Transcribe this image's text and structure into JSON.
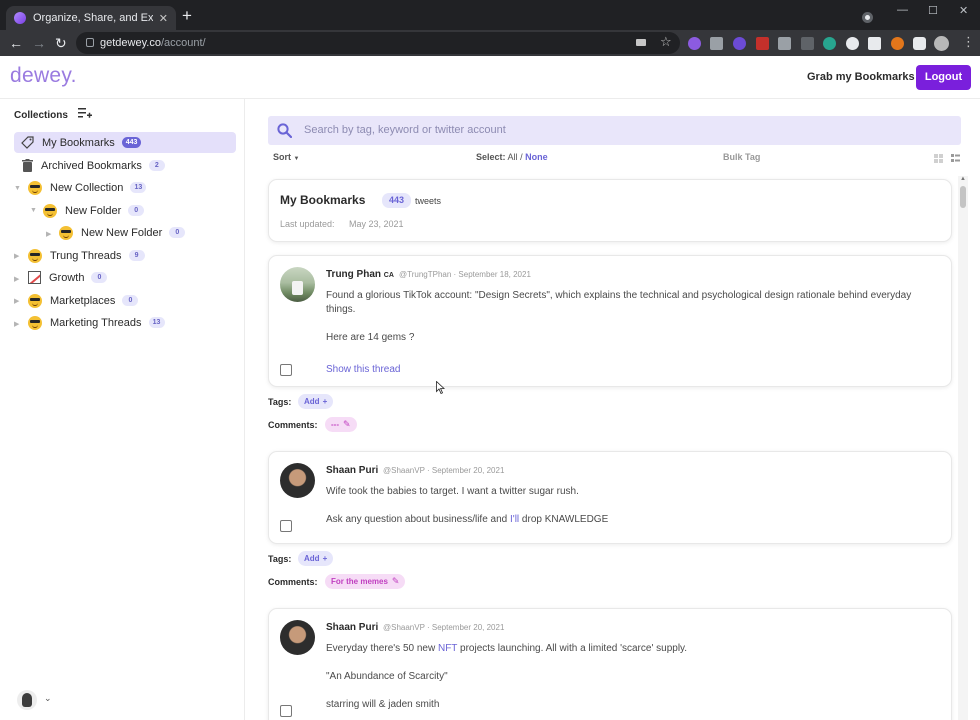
{
  "browser": {
    "tab_title": "Organize, Share, and Export Twitt",
    "url_host": "getdewey.co",
    "url_path": "/account/"
  },
  "header": {
    "logo": "dewey.",
    "grab_label": "Grab my Bookmarks",
    "logout_label": "Logout"
  },
  "sidebar": {
    "title": "Collections",
    "items": [
      {
        "label": "My Bookmarks",
        "count": "443"
      },
      {
        "label": "Archived Bookmarks",
        "count": "2"
      },
      {
        "label": "New Collection",
        "count": "13"
      },
      {
        "label": "New Folder",
        "count": "0"
      },
      {
        "label": "New New Folder",
        "count": "0"
      },
      {
        "label": "Trung Threads",
        "count": "9"
      },
      {
        "label": "Growth",
        "count": "0"
      },
      {
        "label": "Marketplaces",
        "count": "0"
      },
      {
        "label": "Marketing Threads",
        "count": "13"
      }
    ]
  },
  "search": {
    "placeholder": "Search by tag, keyword or twitter account"
  },
  "controls": {
    "sort": "Sort",
    "select_label": "Select:",
    "select_all": "All",
    "select_sep": "/",
    "select_none": "None",
    "bulk_tag": "Bulk Tag"
  },
  "summary": {
    "title": "My Bookmarks",
    "count": "443",
    "unit": "tweets",
    "updated_label": "Last updated:",
    "updated_value": "May 23, 2021"
  },
  "labels": {
    "tags": "Tags:",
    "comments": "Comments:",
    "add": "Add"
  },
  "tweets": [
    {
      "author": "Trung Phan",
      "flag": "CA",
      "meta": "@TrungTPhan · September 18, 2021",
      "line1": "Found a glorious TikTok account: \"Design Secrets\", which explains the technical and psychological design rationale behind everyday",
      "line2": "things.",
      "line3": "Here are 14 gems ?",
      "thread_link": "Show this thread",
      "comment": "---"
    },
    {
      "author": "Shaan Puri",
      "meta": "@ShaanVP · September 20, 2021",
      "line1": "Wife took the babies to target. I want a twitter sugar rush.",
      "line2_pre": "Ask any question about business/life and ",
      "line2_link": "I'll",
      "line2_post": " drop KNAWLEDGE",
      "comment": "For the memes"
    },
    {
      "author": "Shaan Puri",
      "meta": "@ShaanVP · September 20, 2021",
      "line1_pre": "Everyday there's 50 new ",
      "line1_link": "NFT",
      "line1_post": " projects launching. All with a limited 'scarce' supply.",
      "line2": "\"An Abundance of Scarcity\"",
      "line3": "starring will & jaden smith"
    }
  ],
  "colors": {
    "accent": "#7a1fdc",
    "logo": "#9a7be0",
    "badge_text": "#6a64d6",
    "badge_bg": "#e6e6fb",
    "search_bg": "#e9e6fa"
  }
}
